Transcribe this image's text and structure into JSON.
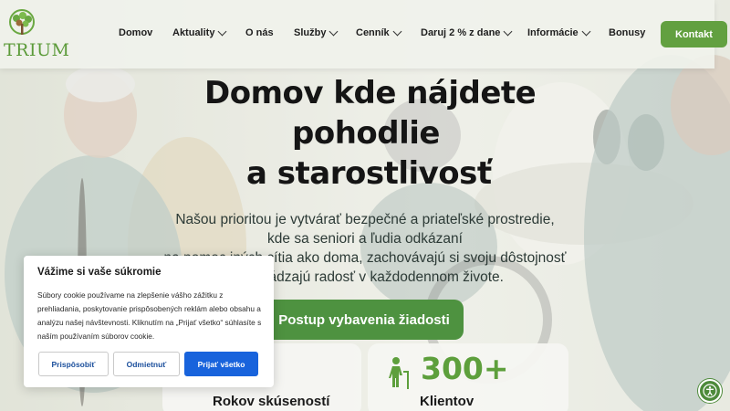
{
  "brand": {
    "logo_text": "TRIUM",
    "accent": "#62a040",
    "icon": "tree-icon"
  },
  "nav": {
    "items": [
      {
        "label": "Domov",
        "dropdown": false
      },
      {
        "label": "Aktuality",
        "dropdown": true
      },
      {
        "label": "O nás",
        "dropdown": false
      },
      {
        "label": "Služby",
        "dropdown": true
      },
      {
        "label": "Cenník",
        "dropdown": true
      },
      {
        "label": "Daruj 2 % z dane",
        "dropdown": true
      },
      {
        "label": "Informácie",
        "dropdown": true
      },
      {
        "label": "Bonusy",
        "dropdown": false
      }
    ],
    "cta_label": "Kontakt"
  },
  "hero": {
    "title_lines": [
      "Domov kde nájdete",
      "pohodlie",
      "a starostlivosť"
    ],
    "lead_lines": [
      "Našou prioritou je vytvárať bezpečné a priateľské prostredie,",
      "kde sa seniori a ľudia odkázaní",
      "na pomoc iných cítia ako doma, zachovávajú si svoju dôstojnosť",
      "a nachádzajú radosť v každodennom živote."
    ],
    "cta_label": "Postup vybavenia žiadosti"
  },
  "stats": [
    {
      "value": "",
      "label": "Rokov skúseností",
      "icon": ""
    },
    {
      "value": "300+",
      "label": "Klientov",
      "icon": "elderly-person-icon"
    }
  ],
  "cookie_banner": {
    "title": "Vážime si vaše súkromie",
    "text": "Súbory cookie používame na zlepšenie vášho zážitku z prehliadania, poskytovanie prispôsobených reklám alebo obsahu a analýzu našej návštevnosti. Kliknutím na „Prijať všetko“ súhlasíte s naším používaním súborov cookie.",
    "buttons": {
      "customize": "Prispôsobiť",
      "reject": "Odmietnuť",
      "accept": "Prijať všetko"
    },
    "primary_color": "#1863dc"
  },
  "accessibility": {
    "icon": "accessibility-icon"
  }
}
